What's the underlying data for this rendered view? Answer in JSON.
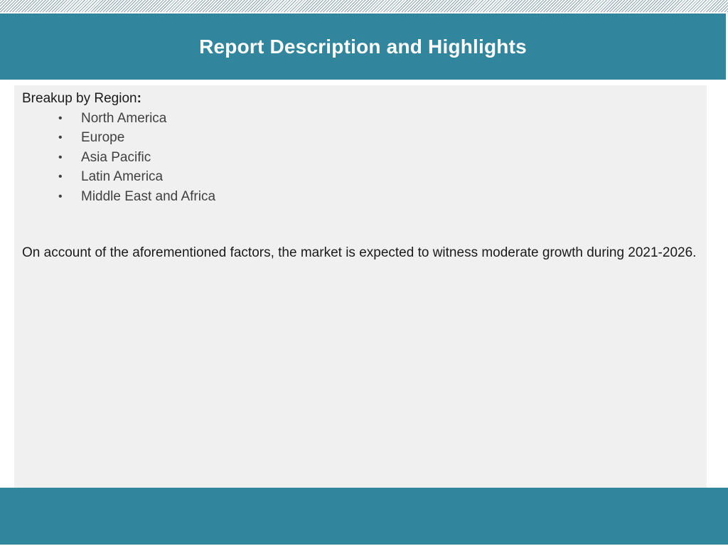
{
  "header": {
    "title": "Report Description and Highlights"
  },
  "content": {
    "region_heading": "Breakup by Region",
    "region_heading_colon": ":",
    "bullet_glyph": "•",
    "regions": [
      "North America",
      "Europe",
      "Asia Pacific",
      "Latin America",
      "Middle East and Africa"
    ],
    "summary": "On account of the aforementioned factors, the market is expected to witness moderate growth during 2021-2026."
  },
  "colors": {
    "accent": "#31859c",
    "panel_background": "#f0f0f0",
    "title_text": "#ffffff"
  }
}
